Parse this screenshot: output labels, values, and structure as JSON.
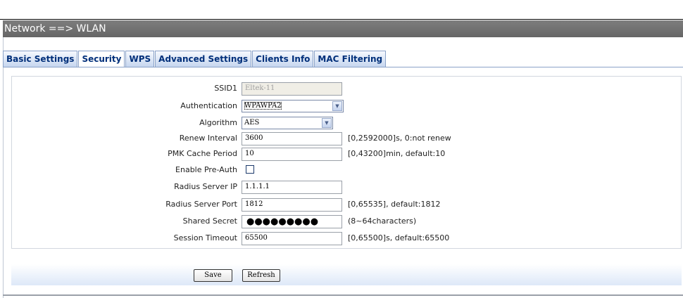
{
  "title": "Network ==> WLAN",
  "tabs": [
    {
      "label": "Basic Settings"
    },
    {
      "label": "Security"
    },
    {
      "label": "WPS"
    },
    {
      "label": "Advanced Settings"
    },
    {
      "label": "Clients Info"
    },
    {
      "label": "MAC Filtering"
    }
  ],
  "form": {
    "ssid": {
      "label": "SSID1",
      "value": "Eltek-11"
    },
    "authentication": {
      "label": "Authentication",
      "value": "WPAWPA2"
    },
    "algorithm": {
      "label": "Algorithm",
      "value": "AES"
    },
    "renew_interval": {
      "label": "Renew Interval",
      "value": "3600",
      "hint": "[0,2592000]s, 0:not renew"
    },
    "pmk_cache": {
      "label": "PMK Cache Period",
      "value": "10",
      "hint": "[0,43200]min, default:10"
    },
    "pre_auth": {
      "label": "Enable Pre-Auth"
    },
    "radius_ip": {
      "label": "Radius Server IP",
      "value": "1.1.1.1"
    },
    "radius_port": {
      "label": "Radius Server Port",
      "value": "1812",
      "hint": "[0,65535], default:1812"
    },
    "shared_secret": {
      "label": "Shared Secret",
      "value": "●●●●●●●●●",
      "hint": "(8~64characters)"
    },
    "session_timeout": {
      "label": "Session Timeout",
      "value": "65500",
      "hint": "[0,65500]s, default:65500"
    }
  },
  "buttons": {
    "save": "Save",
    "refresh": "Refresh"
  },
  "icons": {
    "dropdown": "chevron-down-icon",
    "checkbox": "checkbox-icon"
  },
  "colors": {
    "title_bar": "#747474",
    "tab_text": "#002f7a",
    "button_bar": "#dde8f8"
  }
}
